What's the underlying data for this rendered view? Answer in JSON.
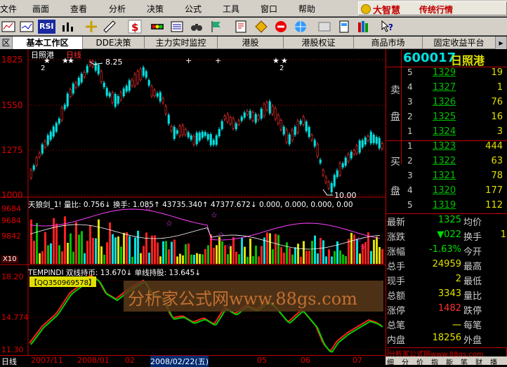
{
  "menubar": {
    "items": [
      "文件",
      "画面",
      "查看",
      "分析",
      "决策",
      "公式",
      "工具",
      "窗口",
      "帮助"
    ],
    "brand_name": "大智慧",
    "brand_sub": "传统行情"
  },
  "toolbar": {
    "rsi": "RSI"
  },
  "tabs": [
    "基本工作区",
    "DDE决策",
    "主力实时监控",
    "港股",
    "港股权证",
    "商品市场",
    "固定收益平台"
  ],
  "chart": {
    "stock_label": "日照港",
    "period": "日线",
    "price_ticks": [
      "1825",
      "1550",
      "1275",
      "1000"
    ],
    "hi_label": "8.25",
    "lo_label": "10.00",
    "marker_2a": "2",
    "marker_2b": "2",
    "ind1_header": "天狼剑_1! 量比: 0.756↓ 换手: 1.085↑ 43735.340↑ 47377.672↓ 0.000, 0.000, 0.000, 0.00",
    "ind1_ticks": [
      "9684",
      "9684",
      "9842"
    ],
    "ind1_x10": "X10",
    "ind2_header": "TEMPINDI 双线持币: 13.670↓ 单线持股: 13.645↓",
    "ind2_qq": "【QQ350969578】",
    "ind2_ticks": [
      "18.20",
      "14.774",
      "11.30"
    ],
    "date_axis": [
      "日线",
      "2007/11",
      "2008/01",
      "02",
      "2008/02/22(五)",
      "05",
      "06",
      "07"
    ],
    "watermark": "分析家公式网www.88gs.com"
  },
  "quote": {
    "code": "600017",
    "name": "日照港",
    "sell_label_a": "卖",
    "sell_label_b": "盘",
    "buy_label_a": "买",
    "buy_label_b": "盘",
    "asks": [
      {
        "lvl": "5",
        "price": "1329",
        "vol": "19"
      },
      {
        "lvl": "4",
        "price": "1327",
        "vol": "1"
      },
      {
        "lvl": "3",
        "price": "1326",
        "vol": "76"
      },
      {
        "lvl": "2",
        "price": "1325",
        "vol": "16"
      },
      {
        "lvl": "1",
        "price": "1324",
        "vol": "3"
      }
    ],
    "bids": [
      {
        "lvl": "1",
        "price": "1323",
        "vol": "444"
      },
      {
        "lvl": "2",
        "price": "1322",
        "vol": "63"
      },
      {
        "lvl": "3",
        "price": "1321",
        "vol": "78"
      },
      {
        "lvl": "4",
        "price": "1320",
        "vol": "177"
      },
      {
        "lvl": "5",
        "price": "1319",
        "vol": "112"
      }
    ],
    "stats": [
      {
        "k": "最新",
        "v": "1325",
        "k2": "均价",
        "v2": ""
      },
      {
        "k": "涨跌",
        "v": "▼022",
        "k2": "换手",
        "v2": "1"
      },
      {
        "k": "涨幅",
        "v": "-1.63%",
        "k2": "今开",
        "v2": ""
      },
      {
        "k": "总手",
        "v": "24959",
        "k2": "最高",
        "v2": ""
      },
      {
        "k": "现手",
        "v": "2",
        "k2": "最低",
        "v2": ""
      },
      {
        "k": "总额",
        "v": "3343",
        "k2": "量比",
        "v2": ""
      },
      {
        "k": "涨停",
        "v": "1482",
        "k2": "跌停",
        "v2": ""
      },
      {
        "k": "总笔",
        "v": "一",
        "k2": "每笔",
        "v2": ""
      },
      {
        "k": "内盘",
        "v": "18256",
        "k2": "外盘",
        "v2": ""
      }
    ],
    "ad": "分析家公式网www.88gs.com",
    "bottom_tabs": [
      "细",
      "分",
      "价",
      "指",
      "能",
      "笔",
      "财",
      "播"
    ]
  },
  "colors": {
    "up": "#ff3030",
    "down": "#00e0e0",
    "green": "#00c000",
    "yellow": "#e0e000"
  }
}
